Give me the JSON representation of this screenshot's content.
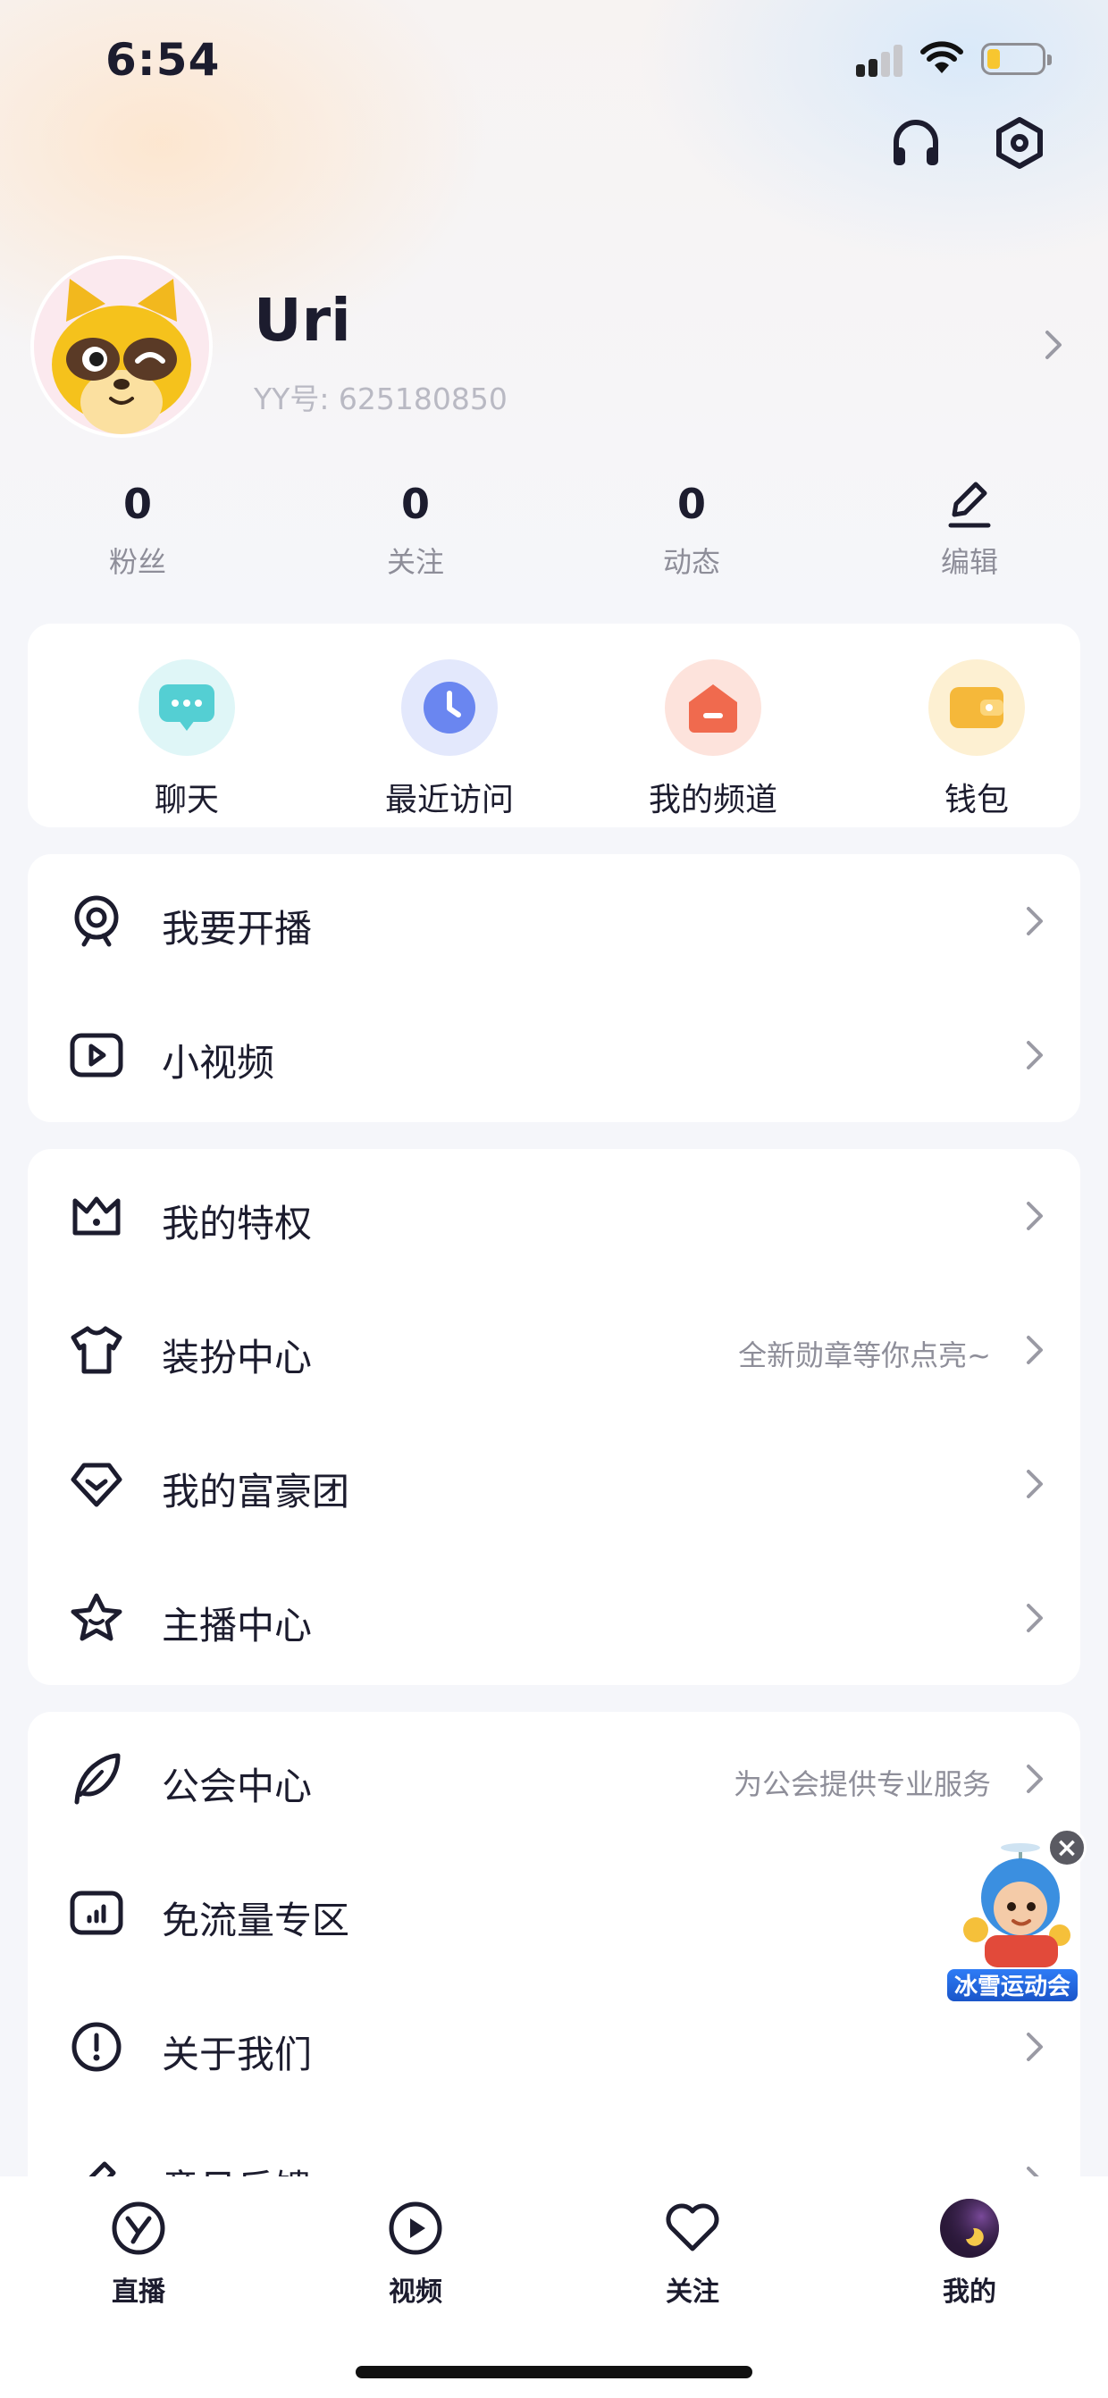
{
  "status_bar": {
    "time": "6:54",
    "battery_color": "#f7c630"
  },
  "header": {
    "support_icon": "headphones-icon",
    "settings_icon": "hexagon-settings-icon"
  },
  "profile": {
    "name": "Uri",
    "yy_id": "YY号: 625180850"
  },
  "stats": [
    {
      "value": "0",
      "label": "粉丝"
    },
    {
      "value": "0",
      "label": "关注"
    },
    {
      "value": "0",
      "label": "动态"
    }
  ],
  "edit_label": "编辑",
  "quick_actions": [
    {
      "label": "聊天",
      "icon": "chat-bubble-icon",
      "color": "#54cfd3"
    },
    {
      "label": "最近访问",
      "icon": "clock-icon",
      "color": "#6a86f0"
    },
    {
      "label": "我的频道",
      "icon": "house-icon",
      "color": "#f06a4e"
    },
    {
      "label": "钱包",
      "icon": "wallet-icon",
      "color": "#f5b83a"
    }
  ],
  "menu_group_1": [
    {
      "label": "我要开播",
      "hint": "",
      "icon": "webcam-icon"
    },
    {
      "label": "小视频",
      "hint": "",
      "icon": "video-play-icon"
    }
  ],
  "menu_group_2": [
    {
      "label": "我的特权",
      "hint": "",
      "icon": "crown-icon"
    },
    {
      "label": "装扮中心",
      "hint": "全新勋章等你点亮~",
      "icon": "tshirt-icon"
    },
    {
      "label": "我的富豪团",
      "hint": "",
      "icon": "diamond-icon"
    },
    {
      "label": "主播中心",
      "hint": "",
      "icon": "star-smile-icon"
    }
  ],
  "menu_group_3": [
    {
      "label": "公会中心",
      "hint": "为公会提供专业服务",
      "icon": "feather-icon"
    },
    {
      "label": "免流量专区",
      "hint": "",
      "icon": "bar-chart-icon"
    },
    {
      "label": "关于我们",
      "hint": "",
      "icon": "exclamation-circle-icon"
    },
    {
      "label": "意见反馈",
      "hint": "",
      "icon": "pen-icon"
    }
  ],
  "floating_promo": {
    "label": "冰雪运动会"
  },
  "tab_bar": [
    {
      "label": "直播",
      "icon": "y-logo-icon"
    },
    {
      "label": "视频",
      "icon": "play-icon"
    },
    {
      "label": "关注",
      "icon": "heart-icon"
    },
    {
      "label": "我的",
      "icon": "moon-avatar-icon",
      "active": true
    }
  ]
}
